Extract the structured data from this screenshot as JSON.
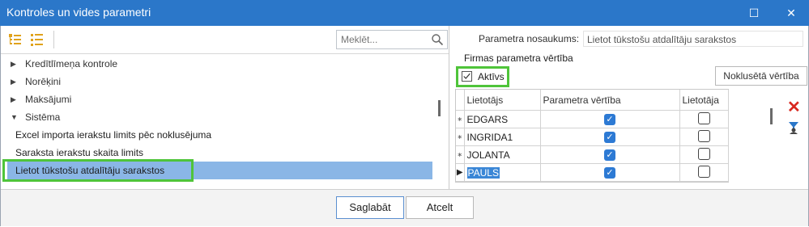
{
  "window": {
    "title": "Kontroles un vides parametri",
    "maximize_glyph": "☐",
    "close_glyph": "✕"
  },
  "left": {
    "search_placeholder": "Meklēt...",
    "tree": [
      {
        "label": "Kredītlīmeņa kontrole",
        "expanded": false
      },
      {
        "label": "Norēķini",
        "expanded": false
      },
      {
        "label": "Maksājumi",
        "expanded": false
      },
      {
        "label": "Sistēma",
        "expanded": true
      },
      {
        "label": "Excel importa ierakstu limits pēc noklusējuma",
        "leaf": true
      },
      {
        "label": "Saraksta ierakstu skaita limits",
        "leaf": true
      },
      {
        "label": "Lietot tūkstošu atdalītāju sarakstos",
        "leaf": true,
        "selected": true
      }
    ],
    "icons": {
      "collapsed": "▶",
      "expanded": "▼"
    }
  },
  "right": {
    "param_name_label": "Parametra nosaukums:",
    "param_name_value": "Lietot tūkstošu atdalītāju sarakstos",
    "firm_value_label": "Firmas parametra vērtība",
    "aktivs_label": "Aktīvs",
    "aktivs_checked": true,
    "default_button": "Noklusētā vērtība",
    "grid": {
      "columns": [
        "Lietotājs",
        "Parametra vērtība",
        "Lietotāja"
      ],
      "rows": [
        {
          "indicator": "∗",
          "user": "EDGARS",
          "param_value": true,
          "user_value": false
        },
        {
          "indicator": "∗",
          "user": "INGRIDA1",
          "param_value": true,
          "user_value": false
        },
        {
          "indicator": "∗",
          "user": "JOLANTA",
          "param_value": true,
          "user_value": false
        },
        {
          "indicator": "▶",
          "user": "PAULS",
          "param_value": true,
          "user_value": false,
          "current": true
        }
      ]
    },
    "delete_glyph": "✕"
  },
  "buttons": {
    "save": "Saglabāt",
    "cancel": "Atcelt"
  },
  "colors": {
    "titlebar": "#2b77c9",
    "selection": "#8ab6e6",
    "highlight_box": "#4fc43a",
    "checkbox_blue": "#2d7ad4",
    "delete_red": "#d8281f"
  }
}
